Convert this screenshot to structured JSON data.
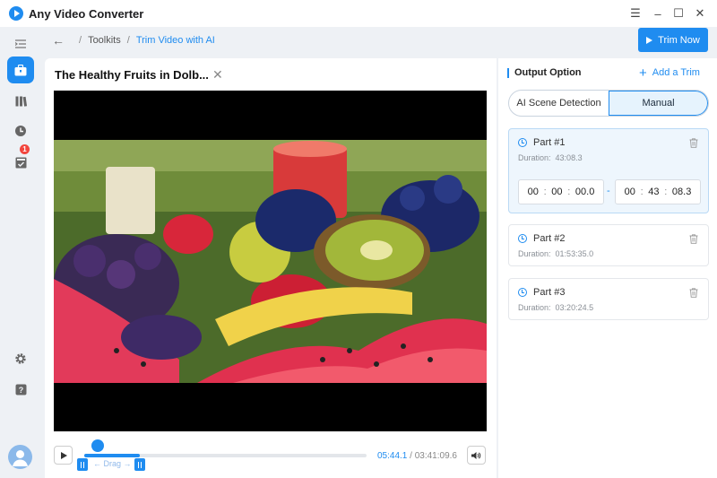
{
  "app": {
    "title": "Any Video Converter"
  },
  "window_controls": {
    "menu": "☰",
    "minimize": "–",
    "maximize": "☐",
    "close": "✕"
  },
  "breadcrumb": {
    "back": "←",
    "root": "Toolkits",
    "separator": "/",
    "current": "Trim Video with AI"
  },
  "toolbar": {
    "trim_now_label": "Trim Now"
  },
  "video": {
    "title": "The Healthy Fruits in Dolb...",
    "close": "✕",
    "current_time": "05:44.1",
    "time_separator": " / ",
    "total_time": "03:41:09.6",
    "progress": 0.025,
    "selection_start": 0.0,
    "selection_end": 0.196,
    "drag_label": "← Drag →"
  },
  "sidebar": {
    "items": [
      {
        "name": "toolkit-icon",
        "active": true
      },
      {
        "name": "library-icon",
        "active": false
      },
      {
        "name": "history-icon",
        "active": false,
        "badge": "1"
      },
      {
        "name": "tasks-icon",
        "active": false
      },
      {
        "name": "settings-icon",
        "active": false
      },
      {
        "name": "help-icon",
        "active": false
      }
    ]
  },
  "output": {
    "title": "Output Option",
    "add_trim_label": "Add a Trim",
    "add_trim_icon": "+",
    "modes": [
      {
        "label": "AI Scene Detection",
        "selected": false
      },
      {
        "label": "Manual",
        "selected": true
      }
    ],
    "parts": [
      {
        "name": "Part #1",
        "duration_label": "Duration:",
        "duration": "43:08.3",
        "selected": true,
        "start": {
          "h": "00",
          "m": "00",
          "s": "00.0"
        },
        "end": {
          "h": "00",
          "m": "43",
          "s": "08.3"
        }
      },
      {
        "name": "Part #2",
        "duration_label": "Duration:",
        "duration": "01:53:35.0",
        "selected": false
      },
      {
        "name": "Part #3",
        "duration_label": "Duration:",
        "duration": "03:20:24.5",
        "selected": false
      }
    ],
    "range_separator": "-",
    "time_colon": ":"
  },
  "colors": {
    "accent": "#1f8cf0",
    "badge": "#f2453d",
    "selected_bg": "#eef6fd"
  }
}
